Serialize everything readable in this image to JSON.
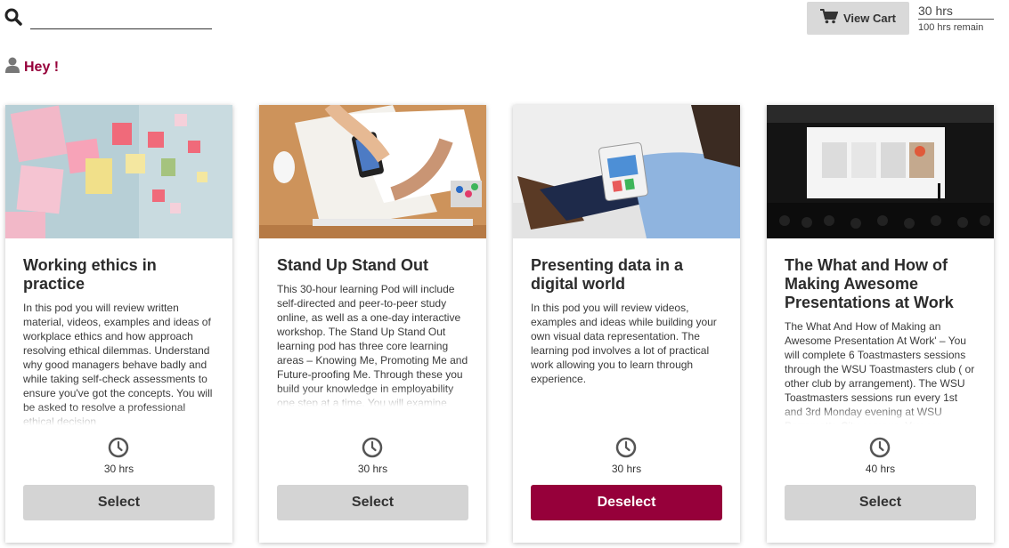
{
  "header": {
    "search_placeholder": "",
    "cart_label": "View Cart",
    "hours_total": "30 hrs",
    "hours_remain": "100 hrs remain"
  },
  "greeting": "Hey !",
  "colors": {
    "accent": "#96003a",
    "button_grey": "#d4d4d4"
  },
  "cards": [
    {
      "title": "Working ethics in practice",
      "desc": "In this pod you will review written material, videos, examples and ideas of workplace ethics and how approach resolving ethical dilemmas. Understand why good managers behave badly and while taking self-check assessments to ensure you've got the concepts. You will be asked to resolve a professional ethical decision",
      "hours": "30 hrs",
      "button": "Select",
      "selected": false
    },
    {
      "title": "Stand Up Stand Out",
      "desc": "This 30-hour learning Pod will include self-directed and peer-to-peer study online, as well as a one-day interactive workshop. The Stand Up Stand Out learning pod has three core learning areas – Knowing Me, Promoting Me and Future-proofing Me. Through these you build your knowledge in employability one step at a time. You will examine your own skills and",
      "hours": "30 hrs",
      "button": "Select",
      "selected": false
    },
    {
      "title": "Presenting data in a digital world",
      "desc": "In this pod you will review videos, examples and ideas while building your own visual data representation. The learning pod involves a lot of practical work allowing you to learn through experience.",
      "hours": "30 hrs",
      "button": "Deselect",
      "selected": true
    },
    {
      "title": "The What and How of Making Awesome Presentations at Work",
      "desc": "The What And How of Making an Awesome Presentation At Work' – You will complete 6 Toastmasters sessions through the WSU Toastmasters club ( or other club by arrangement). The WSU Toastmasters sessions run every 1st and 3rd Monday evening at WSU Parramatta City campus. You can",
      "hours": "40 hrs",
      "button": "Select",
      "selected": false
    }
  ]
}
